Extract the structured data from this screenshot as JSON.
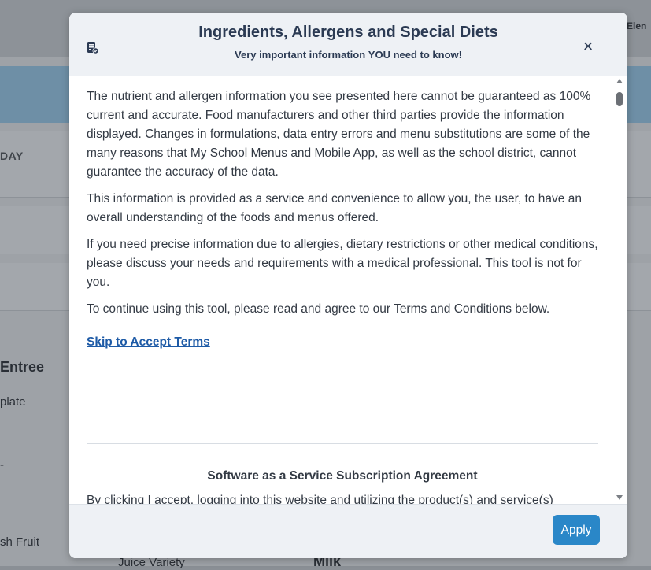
{
  "background": {
    "header_right": "Elen",
    "day_label": "DAY",
    "entree_heading": "Entree",
    "plate_item": "plate",
    "dash_item": "-",
    "fruit_item": "sh Fruit",
    "juice_item": "Juice Variety",
    "milk_heading": "Milk"
  },
  "modal": {
    "icon": "document-check-icon",
    "title": "Ingredients, Allergens and Special Diets",
    "subtitle_pre": "Very important information ",
    "subtitle_bold": "YOU",
    "subtitle_post": " need to know!",
    "close_label": "×",
    "paragraphs": [
      "The nutrient and allergen information you see presented here cannot be guaranteed as 100% current and accurate. Food manufacturers and other third parties provide the information displayed. Changes in formulations, data entry errors and menu substitutions are some of the many reasons that My School Menus and Mobile App, as well as the school district, cannot guarantee the accuracy of the data.",
      "This information is provided as a service and convenience to allow you, the user, to have an overall understanding of the foods and menus offered.",
      "If you need precise information due to allergies, dietary restrictions or other medical conditions, please discuss your needs and requirements with a medical professional. This tool is not for you.",
      "To continue using this tool, please read and agree to our Terms and Conditions below."
    ],
    "skip_link": "Skip to Accept Terms",
    "agreement_title": "Software as a Service Subscription Agreement",
    "cutoff_text": "By clicking I accept, logging into this website and utilizing the product(s) and service(s)",
    "apply_label": "Apply"
  },
  "colors": {
    "accent": "#2a87c8",
    "link": "#1d5aa6",
    "title_text": "#2b3a53"
  }
}
